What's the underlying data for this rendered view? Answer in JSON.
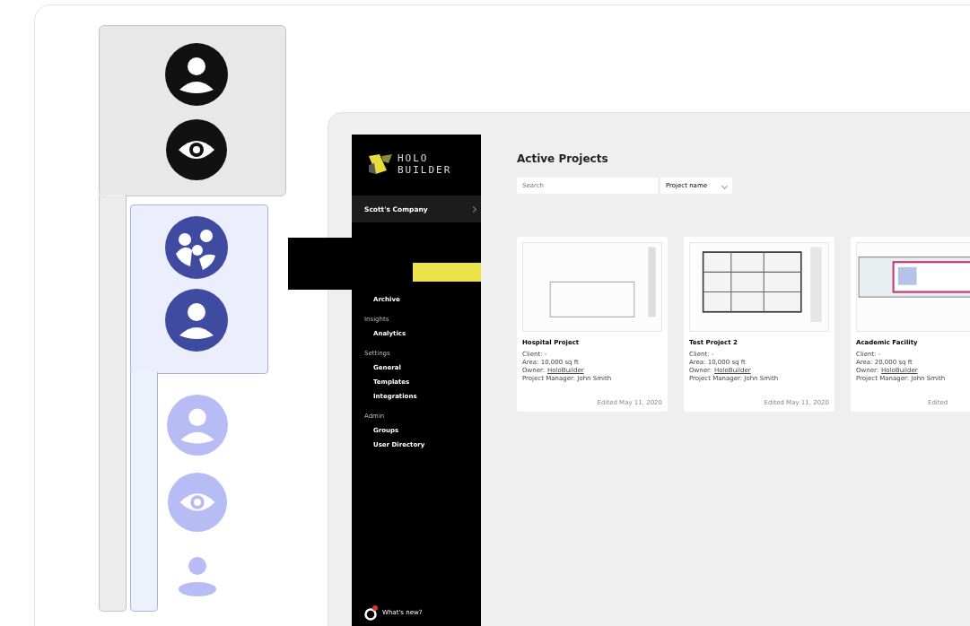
{
  "app": {
    "logo": [
      "HOLO",
      "BUILDER"
    ],
    "company": "Scott's Company",
    "nav": [
      {
        "items": [
          {
            "label": "Archive",
            "selected": false
          }
        ]
      },
      {
        "section": "Insights",
        "items": [
          {
            "label": "Analytics",
            "selected": false
          }
        ]
      },
      {
        "section": "Settings",
        "items": [
          {
            "label": "General",
            "selected": false
          },
          {
            "label": "Templates",
            "selected": false
          },
          {
            "label": "Integrations",
            "selected": false
          }
        ]
      },
      {
        "section": "Admin",
        "items": [
          {
            "label": "Groups",
            "selected": false
          },
          {
            "label": "User Directory",
            "selected": false
          }
        ]
      }
    ],
    "whats_new": "What's new?",
    "title": "Active Projects",
    "search": {
      "placeholder": "Search"
    },
    "sort": {
      "value": "Project name"
    },
    "projects": [
      {
        "name": "Hospital Project",
        "client": "Client: -",
        "area": "Area: 10,000 sq ft",
        "owner_label": "Owner:",
        "owner": "HoloBuilder",
        "manager": "Project Manager: John Smith",
        "edited": "Edited May 11, 2020"
      },
      {
        "name": "Test Project 2",
        "client": "Client: -",
        "area": "Area: 10,000 sq ft",
        "owner_label": "Owner:",
        "owner": "HoloBuilder",
        "manager": "Project Manager: John Smith",
        "edited": "Edited May 11, 2020"
      },
      {
        "name": "Academic Facility",
        "client": "Client: -",
        "area": "Area: 20,000 sq ft",
        "owner_label": "Owner:",
        "owner": "HoloBuilder",
        "manager": "Project Manager: John Smith",
        "edited": "Edited"
      }
    ]
  }
}
